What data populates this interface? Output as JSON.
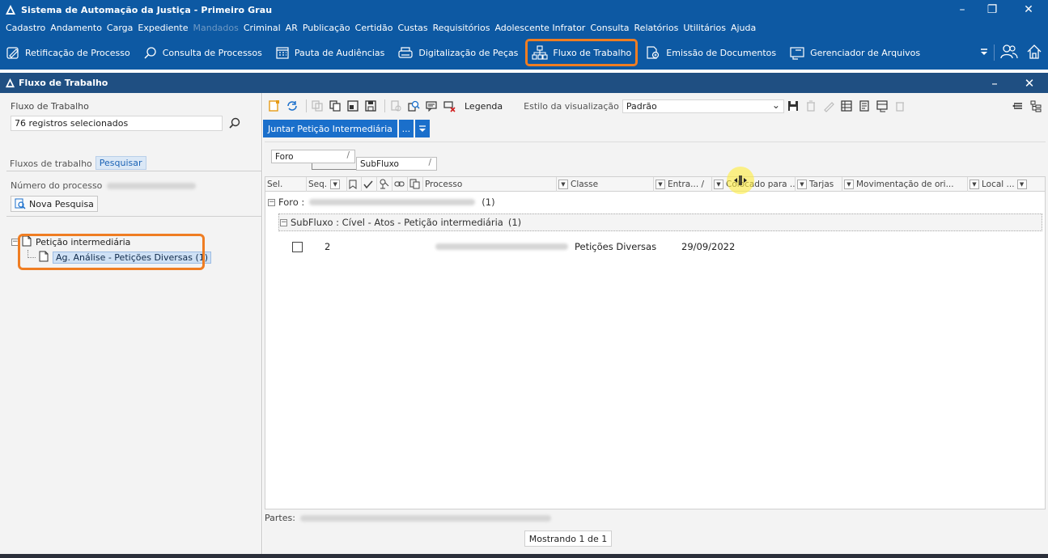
{
  "window": {
    "title": "Sistema de Automação da Justiça - Primeiro Grau",
    "minimize": "–",
    "restore": "❐",
    "close": "✕"
  },
  "menubar": [
    {
      "label": "Cadastro",
      "enabled": true
    },
    {
      "label": "Andamento",
      "enabled": true
    },
    {
      "label": "Carga",
      "enabled": true
    },
    {
      "label": "Expediente",
      "enabled": true
    },
    {
      "label": "Mandados",
      "enabled": false
    },
    {
      "label": "Criminal",
      "enabled": true
    },
    {
      "label": "AR",
      "enabled": true
    },
    {
      "label": "Publicação",
      "enabled": true
    },
    {
      "label": "Certidão",
      "enabled": true
    },
    {
      "label": "Custas",
      "enabled": true
    },
    {
      "label": "Requisitórios",
      "enabled": true
    },
    {
      "label": "Adolescente Infrator",
      "enabled": true
    },
    {
      "label": "Consulta",
      "enabled": true
    },
    {
      "label": "Relatórios",
      "enabled": true
    },
    {
      "label": "Utilitários",
      "enabled": true
    },
    {
      "label": "Ajuda",
      "enabled": true
    }
  ],
  "toolbar": {
    "retificacao": "Retificação de Processo",
    "consulta": "Consulta de Processos",
    "pauta": "Pauta de Audiências",
    "digitalizacao": "Digitalização de Peças",
    "fluxo": "Fluxo de Trabalho",
    "emissao": "Emissão de Documentos",
    "gerenciador": "Gerenciador de Arquivos"
  },
  "document": {
    "title": "Fluxo de Trabalho",
    "minimize": "–",
    "close": "✕"
  },
  "left": {
    "fluxo_label": "Fluxo de Trabalho",
    "fluxo_value": "76 registros selecionados",
    "tabs": [
      {
        "label": "Fluxos de trabalho",
        "active": false
      },
      {
        "label": "Pesquisar",
        "active": true
      }
    ],
    "numero_label": "Número do processo",
    "nova_pesquisa": "Nova Pesquisa",
    "tree": {
      "root": "Petição intermediária",
      "child": "Ag. Análise - Petições Diversas (1)",
      "toggle": "−"
    }
  },
  "right": {
    "legenda": "Legenda",
    "estilo_label": "Estilo da visualização",
    "estilo_value": "Padrão",
    "juntar_btn": "Juntar Petição Intermediária",
    "more_btn": "...",
    "group_chips": {
      "foro": "Foro",
      "subfluxo": "SubFluxo",
      "slash": "/"
    },
    "columns": {
      "sel": "Sel.",
      "seq": "Seq.",
      "processo": "Processo",
      "classe": "Classe",
      "entrada": "Entra... /",
      "colocado": "Colocado para ...",
      "tarjas": "Tarjas",
      "movimentacao": "Movimentação de ori...",
      "local": "Local ..."
    },
    "group_foro": {
      "label": "Foro :",
      "count": "(1)"
    },
    "group_subfluxo": {
      "label": "SubFluxo : Cível - Atos - Petição intermediária",
      "count": "(1)"
    },
    "row": {
      "seq": "2",
      "classe": "Petições Diversas",
      "entrada": "29/09/2022"
    },
    "partes_label": "Partes:",
    "mostrando": "Mostrando 1 de 1"
  }
}
